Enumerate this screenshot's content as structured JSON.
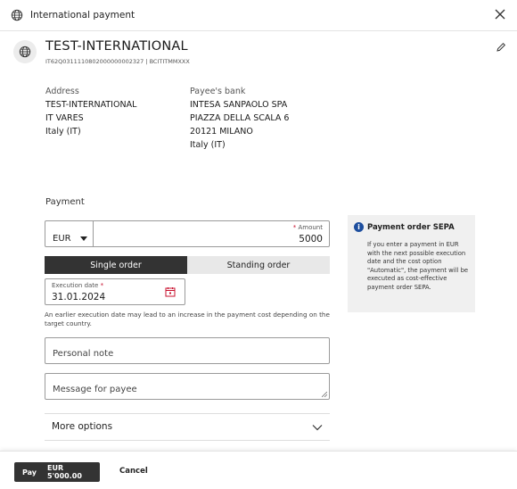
{
  "header": {
    "title": "International payment",
    "close_icon": "close-icon",
    "globe_icon": "globe-icon"
  },
  "payee": {
    "name": "TEST-INTERNATIONAL",
    "iban_bic": "IT62Q0311110802000000002327 | BCITITMMXXX",
    "address_label": "Address",
    "address_lines": [
      "TEST-INTERNATIONAL",
      "IT VARES",
      "Italy (IT)"
    ],
    "bank_label": "Payee's bank",
    "bank_lines": [
      "INTESA SANPAOLO SPA",
      "PIAZZA DELLA SCALA 6",
      "20121 MILANO",
      "Italy (IT)"
    ]
  },
  "payment": {
    "section_label": "Payment",
    "currency": "EUR",
    "amount_label": "Amount",
    "required_marker": "*",
    "amount_value": "5000",
    "single_order_label": "Single order",
    "standing_order_label": "Standing order",
    "execution_date_label": "Execution date",
    "execution_date_value": "31.01.2024",
    "hint": "An earlier execution date may lead to an increase in the payment cost depending on the target country.",
    "personal_note_placeholder": "Personal note",
    "message_placeholder": "Message for payee",
    "more_options_label": "More options"
  },
  "info": {
    "title": "Payment order SEPA",
    "body": "If you enter a payment in EUR with the next possible execution date and the cost option \"Automatic\", the payment will be executed as cost-effective payment order SEPA."
  },
  "footer": {
    "pay_label": "Pay",
    "pay_amount": "EUR 5'000.00",
    "cancel_label": "Cancel"
  },
  "colors": {
    "primary_dark": "#333333",
    "required_red": "#c8102e",
    "info_blue": "#1d4e9e"
  }
}
